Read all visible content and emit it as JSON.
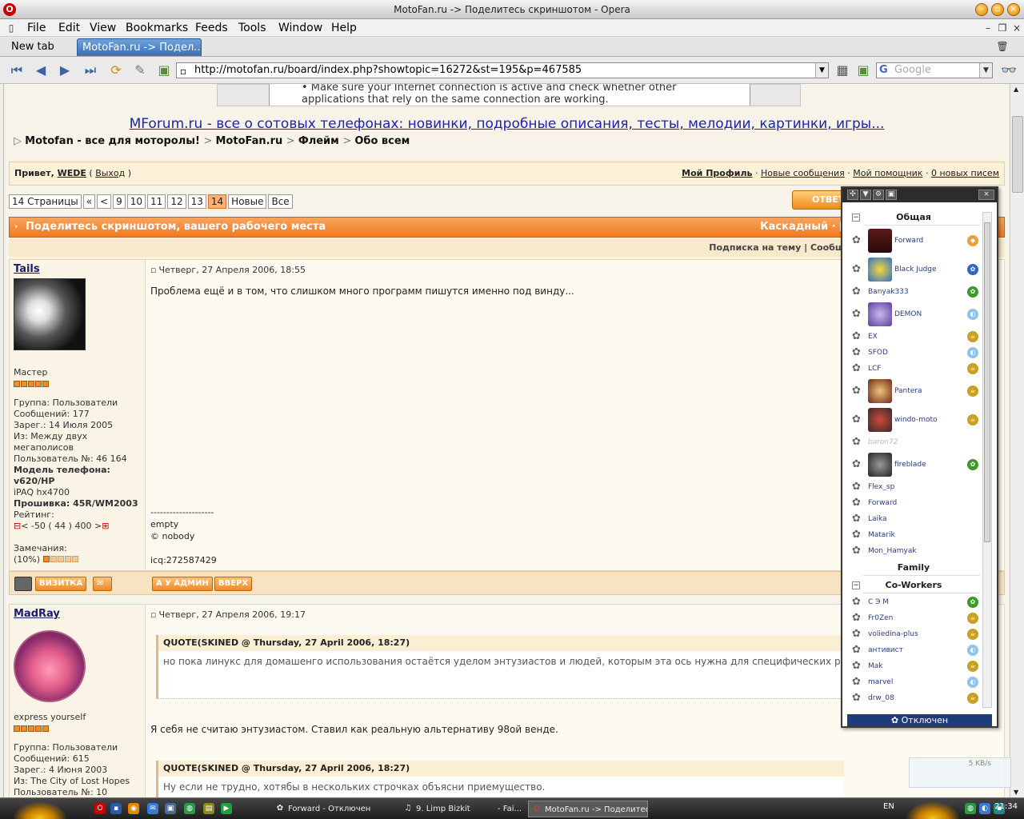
{
  "window": {
    "title": "MotoFan.ru -> Поделитесь скриншотом - Opera"
  },
  "menu": [
    "File",
    "Edit",
    "View",
    "Bookmarks",
    "Feeds",
    "Tools",
    "Window",
    "Help"
  ],
  "tabs": [
    {
      "label": "New tab"
    },
    {
      "label": "MotoFan.ru -> Подел..."
    }
  ],
  "address": {
    "url": "http://motofan.ru/board/index.php?showtopic=16272&st=195&p=467585",
    "search_placeholder": "Google"
  },
  "page": {
    "error_lines": [
      "• Make sure your Internet connection is active and check whether other",
      "applications that rely on the same connection are working."
    ],
    "banner": "MForum.ru - все о сотовых телефонах: новинки, подробные описания, тесты, мелодии, картинки, игры...",
    "breadcrumb": [
      "Motofan - все для моторолы!",
      "MotoFan.ru",
      "Флейм",
      "Обо всем"
    ],
    "welcome": {
      "greet": "Привет, ",
      "user": "WEDE",
      "logout": "Выход",
      "links": [
        "Мой Профиль",
        "Новые сообщения",
        "Мой помощник",
        "0 новых писем"
      ]
    },
    "pager": [
      "14 Страницы",
      "«",
      "<",
      "9",
      "10",
      "11",
      "12",
      "13",
      "14",
      "Новые",
      "Все"
    ],
    "reply_label": "ОТВЕТ",
    "topic_title": "Поделитесь скриншотом, вашего рабочего места",
    "topic_right": "Каскадный · [",
    "subscribe": "Подписка на тему | Сообщ",
    "posts": [
      {
        "user": "Tails",
        "time": "Четверг, 27 Апреля 2006, 18:55",
        "rank": "Мастер",
        "info": [
          "Группа: Пользователи",
          "Сообщений: 177",
          "Зарег.: 14 Июля 2005",
          "Из: Между двух",
          "мегаполисов",
          "Пользователь №: 46 164",
          "Модель телефона: v620/HP",
          "iPAQ hx4700",
          "Прошивка: 45R/WM2003"
        ],
        "rating_label": "Рейтинг:",
        "rating": "< -50 ( 44 ) 400 >",
        "warn_label": "Замечания:",
        "warn": "(10%)",
        "text": "Проблема ещё и в том, что слишком много программ пишутся именно под винду...",
        "sig": [
          "--------------------",
          "empty",
          "© nobody",
          "",
          "icq:272587429"
        ],
        "buttons": [
          "ВИЗИТКА",
          "А У АДМИН",
          "ВВЕРХ"
        ]
      },
      {
        "user": "MadRay",
        "time": "Четверг, 27 Апреля 2006, 19:17",
        "rank": "express yourself",
        "info": [
          "Группа: Пользователи",
          "Сообщений: 615",
          "Зарег.: 4 Июня 2003",
          "Из: The City of Lost Hopes",
          "Пользователь №: 10"
        ],
        "quote1_head": "QUOTE(SKINED @ Thursday, 27 April 2006, 18:27)",
        "quote1_body": "но пока линукс для домашенго использования остаётся уделом энтузиастов и людей, которым эта ось нужна для специфических р",
        "text": "Я себя не считаю энтузиастом. Ставил как реальную альтернативу 98ой венде.",
        "quote2_head": "QUOTE(SKINED @ Thursday, 27 April 2006, 18:27)",
        "quote2_body": "Ну если не трудно, хотябы в нескольких строчках объясни приемущество."
      }
    ]
  },
  "icq": {
    "groups": [
      {
        "name": "Общая",
        "contacts": [
          "Forward",
          "Black Judge",
          "Banyak333",
          "DEMON",
          "EX",
          "SFOD",
          "LCF",
          "Pantera",
          "windo-moto",
          "baron72",
          "fireblade",
          "Flex_sp",
          "Forward",
          "Laika",
          "Matarik",
          "Mon_Hamyak"
        ]
      },
      {
        "name": "Family",
        "contacts": []
      },
      {
        "name": "Co-Workers",
        "contacts": [
          "С Э М",
          "Fr0Zen",
          "voliedina-plus",
          "антивист",
          "Mak",
          "marvel",
          "drw_08"
        ]
      }
    ],
    "status": "Отключен"
  },
  "speed": "5 KB/s",
  "taskbar": {
    "tasks": [
      "Forward - Отключен",
      "9. Limp Bizkit",
      "- Fai...",
      "MotoFan.ru -> Поделитес..."
    ],
    "lang": "EN",
    "clock": "21:34"
  }
}
